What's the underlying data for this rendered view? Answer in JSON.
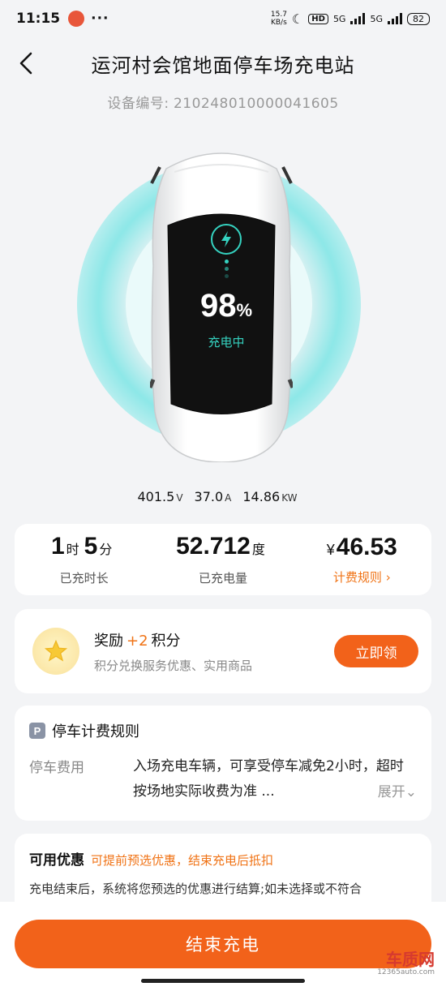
{
  "status_bar": {
    "time": "11:15",
    "dots": "···",
    "net_speed_value": "15.7",
    "net_speed_unit": "KB/s",
    "hd_label": "HD",
    "net1": "5G",
    "net2": "5G",
    "battery": "82"
  },
  "header": {
    "title": "运河村会馆地面停车场充电站",
    "device_label": "设备编号:",
    "device_id": "210248010000041605"
  },
  "charging": {
    "percent": "98",
    "percent_sign": "%",
    "status": "充电中",
    "voltage": "401.5",
    "voltage_unit": "V",
    "current": "37.0",
    "current_unit": "A",
    "power": "14.86",
    "power_unit": "KW"
  },
  "stats": {
    "duration_hours": "1",
    "hours_unit": "时",
    "duration_minutes": "5",
    "minutes_unit": "分",
    "duration_label": "已充时长",
    "energy": "52.712",
    "energy_unit": "度",
    "energy_label": "已充电量",
    "currency": "¥",
    "cost": "46.53",
    "cost_link": "计费规则 ›"
  },
  "reward": {
    "title": "奖励",
    "points": "+2",
    "points_unit": "积分",
    "subtitle": "积分兑换服务优惠、实用商品",
    "claim_button": "立即领"
  },
  "parking": {
    "badge": "P",
    "title": "停车计费规则",
    "fee_label": "停车费用",
    "fee_desc": "入场充电车辆，可享受停车减免2小时，超时按场地实际收费为准 ...",
    "expand": "展开⌄"
  },
  "coupon": {
    "title": "可用优惠",
    "hint": "可提前预选优惠，结束充电后抵扣",
    "desc": "充电结束后，系统将您预选的优惠进行结算;如未选择或不符合"
  },
  "bottom": {
    "end_button": "结束充电"
  },
  "watermark": {
    "brand": "车质网",
    "site": "12365auto.com"
  },
  "colors": {
    "accent": "#f2621a",
    "link": "#f07316",
    "teal": "#35d2c0",
    "glow": "#82e6e6"
  }
}
